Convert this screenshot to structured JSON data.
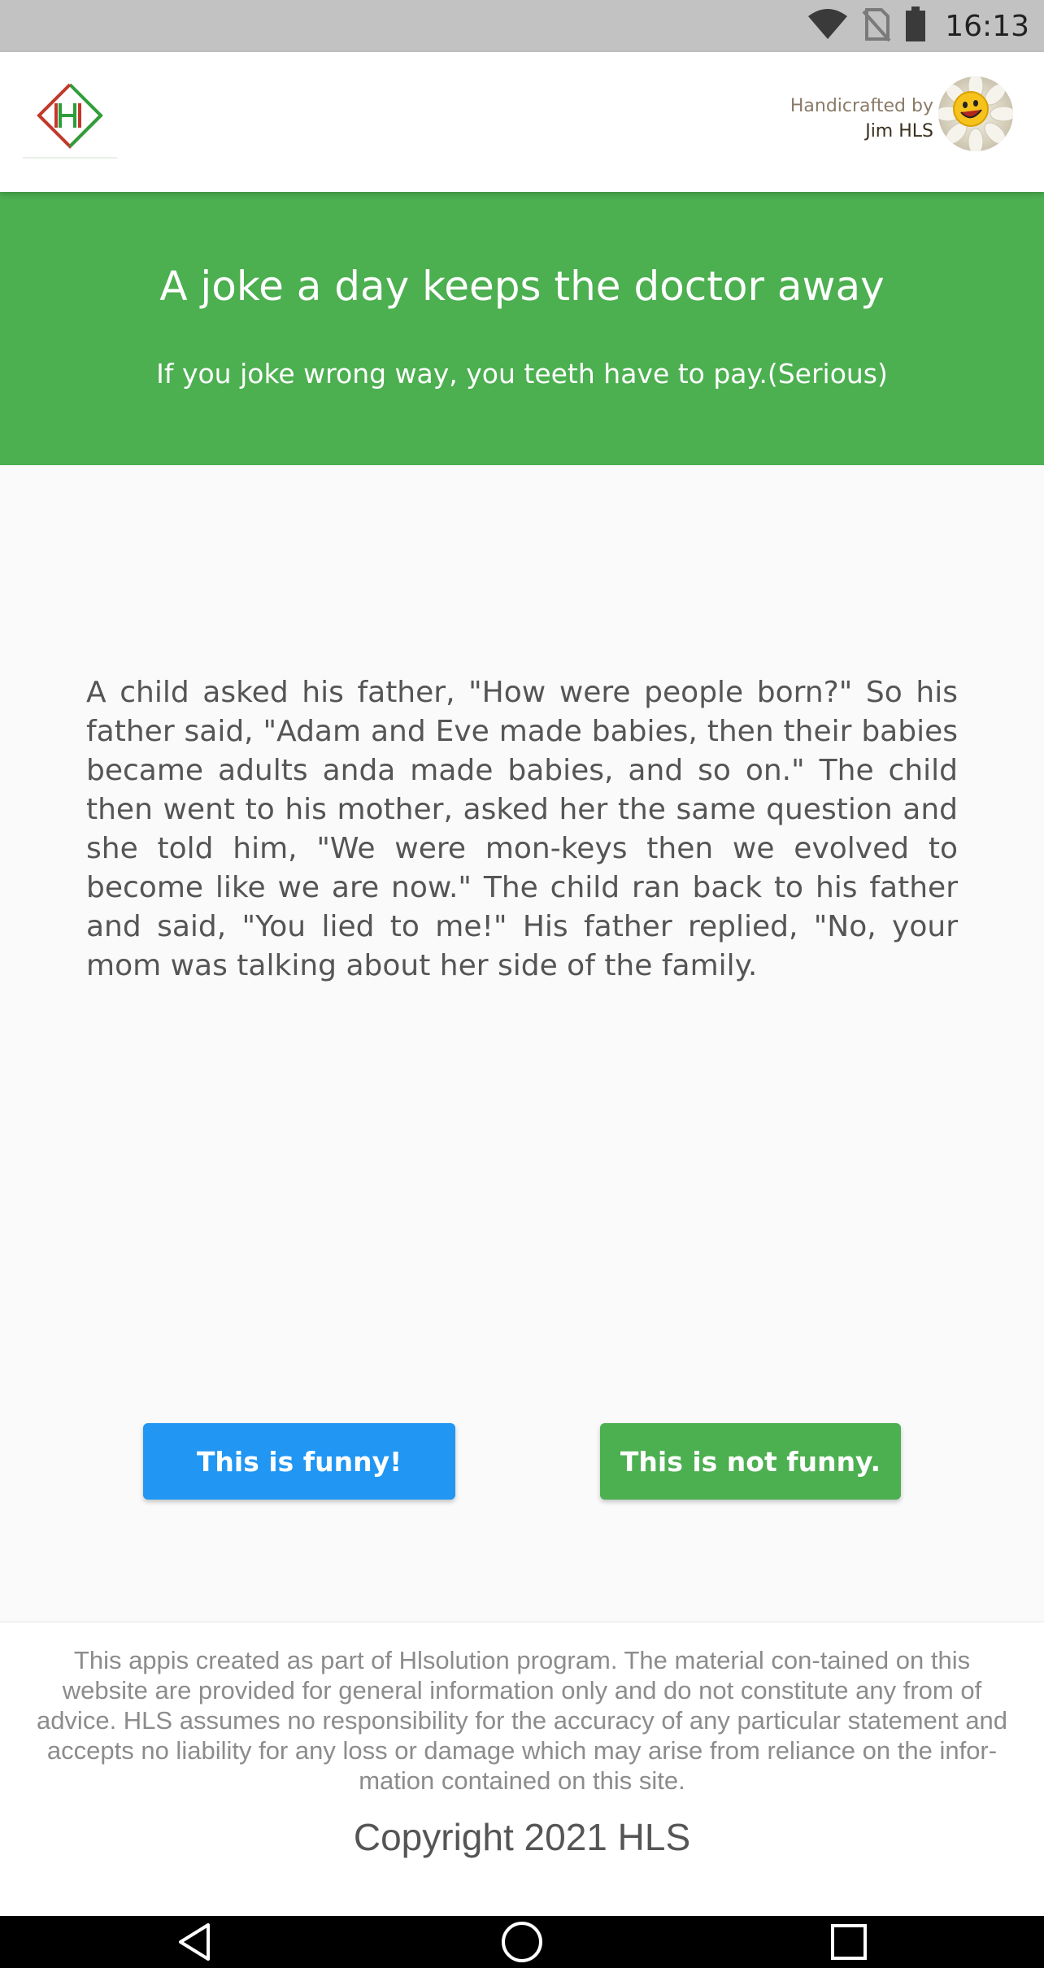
{
  "status_bar": {
    "time": "16:13",
    "icons": [
      "wifi-icon",
      "no-sim-icon",
      "battery-icon"
    ]
  },
  "header": {
    "logo": "H",
    "credit_line1": "Handicrafted by",
    "credit_line2": "Jim HLS",
    "avatar_icon": "smiley-flower-icon"
  },
  "hero": {
    "title": "A joke a day keeps the doctor away",
    "subtitle": "If you joke wrong way, you teeth have to pay.(Serious)",
    "color": "#4caf50"
  },
  "joke": {
    "text": "A child asked his father, \"How were people born?\" So his father said, \"Adam and Eve made babies, then their babies became adults anda made babies, and so on.\" The child then went to his mother, asked her the same question and she told him, \"We were mon-keys then we evolved to become like we are now.\" The child ran back to his father and said, \"You lied to me!\" His father replied, \"No, your mom was talking  about her side of the family."
  },
  "buttons": {
    "funny_label": "This is funny!",
    "funny_color": "#2196f3",
    "not_funny_label": "This is not funny.",
    "not_funny_color": "#4caf50"
  },
  "footer": {
    "disclaimer": "This appis created as part of Hlsolution program. The material con-tained on this website are provided for general information only and do not constitute any from of advice. HLS assumes no responsibility for the accuracy of any particular statement and accepts no liability for any loss or damage which may arise from reliance on the infor-mation contained on this site.",
    "copyright": "Copyright 2021 HLS"
  },
  "nav_bar": {
    "icons": [
      "back-icon",
      "home-icon",
      "recents-icon"
    ]
  }
}
